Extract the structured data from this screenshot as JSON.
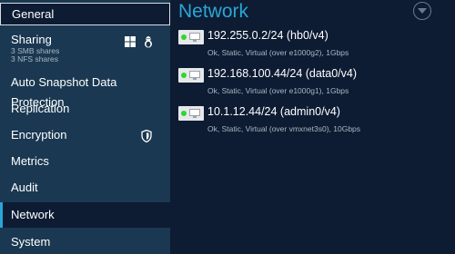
{
  "sidebar": {
    "items": [
      {
        "label": "General"
      },
      {
        "label": "Sharing",
        "sub": [
          "3 SMB shares",
          "3 NFS shares"
        ]
      },
      {
        "label": "Auto Snapshot Data Protection"
      },
      {
        "label": "Replication"
      },
      {
        "label": "Encryption"
      },
      {
        "label": "Metrics"
      },
      {
        "label": "Audit"
      },
      {
        "label": "Network"
      },
      {
        "label": "System"
      }
    ],
    "sharing_icons": [
      "windows-icon",
      "linux-icon"
    ],
    "encryption_icon": "shield-icon"
  },
  "main": {
    "title": "Network",
    "interfaces": [
      {
        "address": "192.255.0.2/24 (hb0/v4)",
        "detail": "Ok, Static, Virtual (over e1000g2), 1Gbps"
      },
      {
        "address": "192.168.100.44/24 (data0/v4)",
        "detail": "Ok, Static, Virtual (over e1000g1), 1Gbps"
      },
      {
        "address": "10.1.12.44/24 (admin0/v4)",
        "detail": "Ok, Static, Virtual (over vmxnet3s0), 10Gbps"
      }
    ]
  },
  "colors": {
    "background": "#0d1c33",
    "sidebar": "#1a3851",
    "accent": "#2aa6d6",
    "status_ok": "#2fd62f"
  }
}
